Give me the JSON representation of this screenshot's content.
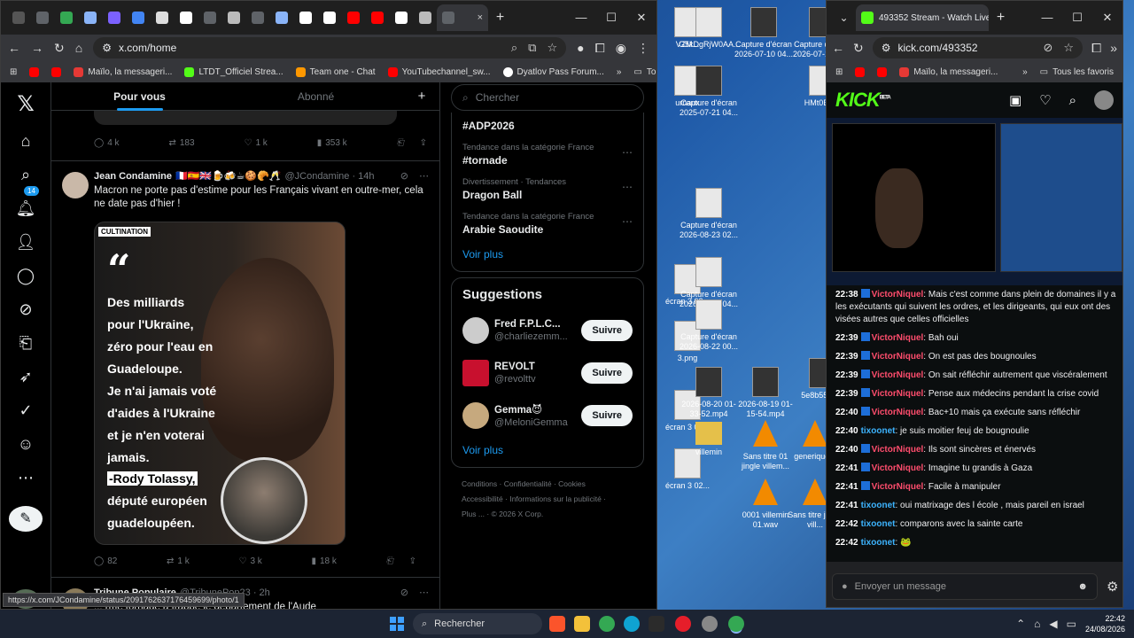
{
  "desktop": {
    "icons": [
      {
        "label": "VZM...",
        "kind": "file"
      },
      {
        "label": "G5kDgRjW0AA...",
        "kind": "file"
      },
      {
        "label": "Capture d'écran 2026-07-10 04...",
        "kind": "img"
      },
      {
        "label": "Capture d'écran 2026-07-10 04...",
        "kind": "img"
      },
      {
        "label": "urnaux",
        "kind": "file"
      },
      {
        "label": "Capture d'écran 2025-07-21 04...",
        "kind": "img"
      },
      {
        "label": "HMt0BZ...",
        "kind": "file"
      },
      {
        "label": "Capture d'écran 2026-08-23 02...",
        "kind": "file"
      },
      {
        "label": "écran 3 02...",
        "kind": "file"
      },
      {
        "label": "Capture d'écran 2026-08-22 04...",
        "kind": "file"
      },
      {
        "label": "3.png",
        "kind": "file"
      },
      {
        "label": "Capture d'écran 2026-08-22 00...",
        "kind": "file"
      },
      {
        "label": "écran 3 02...",
        "kind": "file"
      },
      {
        "label": "2026-08-20 01-33-52.mp4",
        "kind": "img"
      },
      {
        "label": "2026-08-19 01-15-54.mp4",
        "kind": "img"
      },
      {
        "label": "5e8b5581...",
        "kind": "img"
      },
      {
        "label": "écran 3 02...",
        "kind": "file"
      },
      {
        "label": "villemin",
        "kind": "folder"
      },
      {
        "label": "Sans titre 01 jingle villem...",
        "kind": "vlc"
      },
      {
        "label": "generique...",
        "kind": "vlc"
      },
      {
        "label": "0001 villemin 01.wav",
        "kind": "vlc"
      },
      {
        "label": "Sans titre jingle vill...",
        "kind": "vlc"
      }
    ]
  },
  "chrome_x": {
    "url": "x.com/home",
    "tab_close": "×",
    "new_tab": "+",
    "bookmarks": [
      {
        "label": "",
        "color": "#ff0000"
      },
      {
        "label": "",
        "color": "#ff0000"
      },
      {
        "label": "Maïlo, la messageri...",
        "color": "#e53935"
      },
      {
        "label": "LTDT_Officiel Strea...",
        "color": "#53fc18"
      },
      {
        "label": "Team one - Chat",
        "color": "#ff9800"
      },
      {
        "label": "YouTubechannel_sw...",
        "color": "#ff0000"
      },
      {
        "label": "Dyatlov Pass Forum...",
        "color": "#ffffff"
      }
    ],
    "all_bookmarks": "Tous les favoris",
    "status_url": "https://x.com/JCondamine/status/2091762637176459699/photo/1"
  },
  "x": {
    "tabs": [
      "Pour vous",
      "Abonné"
    ],
    "prev_actions": {
      "replies": "4 k",
      "reposts": "183",
      "likes": "1 k",
      "views": "353 k"
    },
    "notif_badge": "14",
    "tweet": {
      "name": "Jean Condamine",
      "flags": "🇫🇷🇪🇸🇬🇧🍺🍻☕🍪🥐🥂",
      "handle": "@JCondamine · 14h",
      "text": "Macron ne porte pas d'estime pour les Français vivant en outre-mer, cela ne date pas d'hier !",
      "image": {
        "tag": "CULTINATION",
        "quote_mark": "“",
        "quote": "Des milliards\npour l'Ukraine,\nzéro pour l'eau en\nGuadeloupe.\nJe n'ai jamais voté\nd'aides à l'Ukraine\net je n'en voterai\njamais.",
        "author_name": "-Rody Tolassy,",
        "author_role": "député européen\nguadeloupéen."
      },
      "actions": {
        "replies": "82",
        "reposts": "1 k",
        "likes": "3 k",
        "views": "18 k"
      }
    },
    "tweet2": {
      "name": "Tribune Populaire",
      "handle": "@TribunePop23 · 2h",
      "text": "... rme tornade a frappé le département de l'Aude"
    },
    "search_placeholder": "Chercher",
    "trends": [
      {
        "category": "",
        "name": "#ADP2026"
      },
      {
        "category": "Tendance dans la catégorie France",
        "name": "#tornade"
      },
      {
        "category": "Divertissement · Tendances",
        "name": "Dragon Ball"
      },
      {
        "category": "Tendance dans la catégorie France",
        "name": "Arabie Saoudite"
      }
    ],
    "show_more": "Voir plus",
    "suggestions_title": "Suggestions",
    "suggestions": [
      {
        "name": "Fred F.P.L.C...",
        "handle": "@charliezemm...",
        "button": "Suivre"
      },
      {
        "name": "REVOLT",
        "handle": "@revolttv",
        "button": "Suivre"
      },
      {
        "name": "Gemma😈",
        "handle": "@MeloniGemma",
        "button": "Suivre"
      }
    ],
    "footer": [
      "Conditions",
      "Confidentialité",
      "Cookies",
      "Accessibilité",
      "Informations sur la publicité",
      "Plus ...",
      "© 2026 X Corp."
    ]
  },
  "chrome_kick": {
    "tab_title": "493352 Stream - Watch Live on",
    "url": "kick.com/493352",
    "bookmarks": [
      "Maïlo, la messageri..."
    ],
    "all_bookmarks": "Tous les favoris",
    "logo": "KICK",
    "logo_sup": "BETA",
    "chat": [
      {
        "time": "22:38",
        "user": "VictorNiquel",
        "color": "u1",
        "text": "Mais c'est comme dans plein de domaines il y a les exécutants qui suivent les ordres, et les dirigeants, qui eux ont des visées autres que celles officielles"
      },
      {
        "time": "22:39",
        "user": "VictorNiquel",
        "color": "u1",
        "text": "Bah oui"
      },
      {
        "time": "22:39",
        "user": "VictorNiquel",
        "color": "u1",
        "text": "On est pas des bougnoules"
      },
      {
        "time": "22:39",
        "user": "VictorNiquel",
        "color": "u1",
        "text": "On sait réfléchir autrement que viscéralement"
      },
      {
        "time": "22:39",
        "user": "VictorNiquel",
        "color": "u1",
        "text": "Pense aux médecins pendant la crise covid"
      },
      {
        "time": "22:40",
        "user": "VictorNiquel",
        "color": "u1",
        "text": "Bac+10 mais ça exécute sans réfléchir"
      },
      {
        "time": "22:40",
        "user": "tixoonet",
        "color": "u2",
        "text": "je suis moitier feuj de bougnoulie"
      },
      {
        "time": "22:40",
        "user": "VictorNiquel",
        "color": "u1",
        "text": "Ils sont sincères et énervés"
      },
      {
        "time": "22:41",
        "user": "VictorNiquel",
        "color": "u1",
        "text": "Imagine tu grandis à Gaza"
      },
      {
        "time": "22:41",
        "user": "VictorNiquel",
        "color": "u1",
        "text": "Facile à manipuler"
      },
      {
        "time": "22:41",
        "user": "tixoonet",
        "color": "u2",
        "text": "oui matrixage des l école , mais pareil en israel"
      },
      {
        "time": "22:42",
        "user": "tixoonet",
        "color": "u2",
        "text": "comparons avec la sainte carte"
      },
      {
        "time": "22:42",
        "user": "tixoonet",
        "color": "u2",
        "text": "🐸"
      }
    ],
    "chat_placeholder": "Envoyer un message"
  },
  "taskbar": {
    "search": "Rechercher",
    "time": "22:42",
    "date": "24/08/2026"
  }
}
